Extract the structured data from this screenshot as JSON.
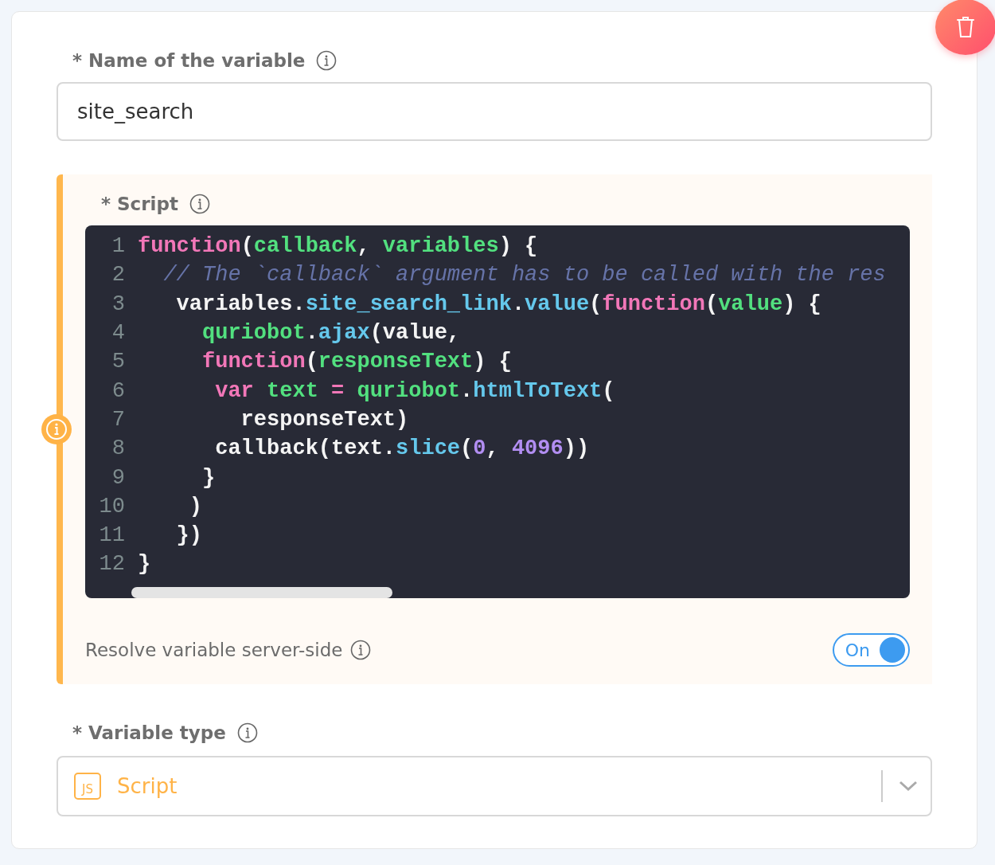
{
  "name_field": {
    "label": "Name of the variable",
    "required_mark": "*",
    "value": "site_search"
  },
  "script_section": {
    "label": "Script",
    "required_mark": "*",
    "code_lines": [
      {
        "number": "1",
        "tokens": [
          {
            "kind": "keyword",
            "text": "function"
          },
          {
            "kind": "plain",
            "text": "("
          },
          {
            "kind": "param",
            "text": "callback"
          },
          {
            "kind": "plain",
            "text": ", "
          },
          {
            "kind": "param",
            "text": "variables"
          },
          {
            "kind": "plain",
            "text": ") {"
          }
        ]
      },
      {
        "number": "2",
        "tokens": [
          {
            "kind": "comment",
            "text": "  // The `callback` argument has to be called with the res"
          }
        ]
      },
      {
        "number": "3",
        "tokens": [
          {
            "kind": "plain",
            "text": "   variables."
          },
          {
            "kind": "method",
            "text": "site_search_link"
          },
          {
            "kind": "plain",
            "text": "."
          },
          {
            "kind": "method",
            "text": "value"
          },
          {
            "kind": "plain",
            "text": "("
          },
          {
            "kind": "keyword",
            "text": "function"
          },
          {
            "kind": "plain",
            "text": "("
          },
          {
            "kind": "param",
            "text": "value"
          },
          {
            "kind": "plain",
            "text": ") {"
          }
        ]
      },
      {
        "number": "4",
        "tokens": [
          {
            "kind": "param",
            "text": "     quriobot"
          },
          {
            "kind": "plain",
            "text": "."
          },
          {
            "kind": "method",
            "text": "ajax"
          },
          {
            "kind": "plain",
            "text": "(value,"
          }
        ]
      },
      {
        "number": "5",
        "tokens": [
          {
            "kind": "keyword",
            "text": "     function"
          },
          {
            "kind": "plain",
            "text": "("
          },
          {
            "kind": "param",
            "text": "responseText"
          },
          {
            "kind": "plain",
            "text": ") {"
          }
        ]
      },
      {
        "number": "6",
        "tokens": [
          {
            "kind": "keyword",
            "text": "      var"
          },
          {
            "kind": "param",
            "text": " text"
          },
          {
            "kind": "keyword",
            "text": " ="
          },
          {
            "kind": "param",
            "text": " quriobot"
          },
          {
            "kind": "plain",
            "text": "."
          },
          {
            "kind": "method",
            "text": "htmlToText"
          },
          {
            "kind": "plain",
            "text": "("
          }
        ]
      },
      {
        "number": "7",
        "tokens": [
          {
            "kind": "plain",
            "text": "        responseText)"
          }
        ]
      },
      {
        "number": "8",
        "tokens": [
          {
            "kind": "plain",
            "text": "      callback(text."
          },
          {
            "kind": "method",
            "text": "slice"
          },
          {
            "kind": "plain",
            "text": "("
          },
          {
            "kind": "number",
            "text": "0"
          },
          {
            "kind": "plain",
            "text": ", "
          },
          {
            "kind": "number",
            "text": "4096"
          },
          {
            "kind": "plain",
            "text": "))"
          }
        ]
      },
      {
        "number": "9",
        "tokens": [
          {
            "kind": "plain",
            "text": "     }"
          }
        ]
      },
      {
        "number": "10",
        "tokens": [
          {
            "kind": "plain",
            "text": "    )"
          }
        ]
      },
      {
        "number": "11",
        "tokens": [
          {
            "kind": "plain",
            "text": "   })"
          }
        ]
      },
      {
        "number": "12",
        "tokens": [
          {
            "kind": "plain",
            "text": "}"
          }
        ]
      }
    ],
    "server_side": {
      "label": "Resolve variable server-side",
      "toggle_label": "On",
      "on": true
    }
  },
  "type_field": {
    "label": "Variable type",
    "required_mark": "*",
    "icon_text": "JS",
    "value": "Script"
  }
}
